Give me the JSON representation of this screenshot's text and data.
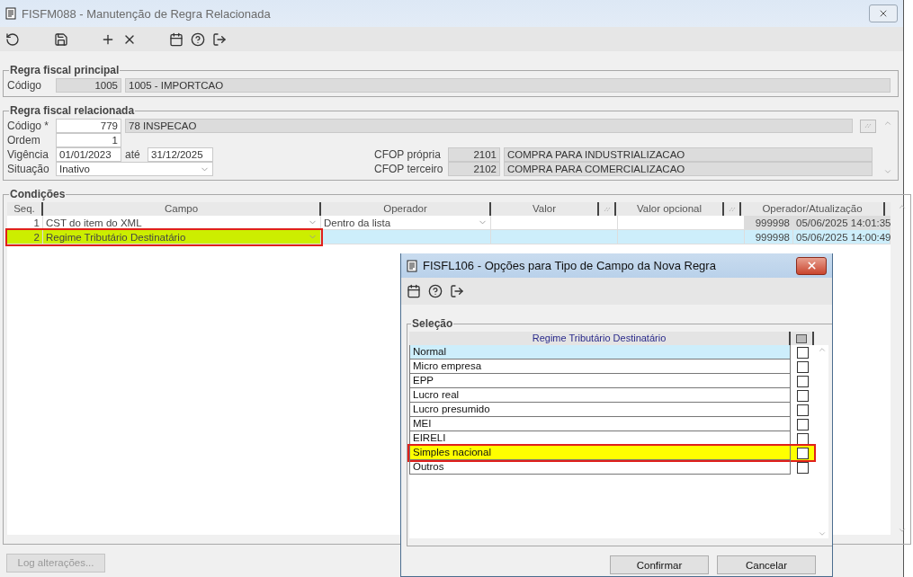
{
  "window": {
    "title": "FISFM088 - Manutenção de Regra Relacionada"
  },
  "regra_principal": {
    "legend": "Regra fiscal principal",
    "label": "Código",
    "code": "1005",
    "description": "1005 - IMPORTCAO"
  },
  "regra_relacionada": {
    "legend": "Regra fiscal relacionada",
    "codigo_label": "Código *",
    "codigo": "779",
    "descricao": "78 INSPECAO",
    "ordem_label": "Ordem",
    "ordem": "1",
    "vigencia_label": "Vigência",
    "vigencia_inicio": "01/01/2023",
    "ate_label": "até",
    "vigencia_fim": "31/12/2025",
    "situacao_label": "Situação",
    "situacao": "Inativo",
    "cfop": [
      {
        "label": "CFOP própria",
        "code": "2101",
        "description": "COMPRA PARA INDUSTRIALIZACAO"
      },
      {
        "label": "CFOP terceiro",
        "code": "2102",
        "description": "COMPRA PARA COMERCIALIZACAO"
      }
    ]
  },
  "condicoes": {
    "legend": "Condições",
    "columns": [
      "Seq.",
      "Campo",
      "Operador",
      "Valor",
      "Valor opcional",
      "Operador/Atualização"
    ],
    "rows": [
      {
        "seq": "1",
        "campo": "CST do item do XML",
        "operador": "Dentro da lista",
        "usuario": "999998",
        "atualizacao": "05/06/2025 14:01:35",
        "selected": false,
        "highlighted": false
      },
      {
        "seq": "2",
        "campo": "Regime Tributário Destinatário",
        "usuario": "999998",
        "atualizacao": "05/06/2025 14:00:49",
        "selected": true,
        "highlighted": true
      }
    ]
  },
  "log_button": {
    "label": "Log alterações...",
    "disabled": true
  },
  "dialog": {
    "title": "FISFL106 - Opções para Tipo de Campo da Nova Regra",
    "legend": "Seleção",
    "column": "Regime Tributário Destinatário",
    "select_all_checked": false,
    "options": [
      {
        "label": "Normal",
        "checked": false,
        "selected": true,
        "highlighted": false
      },
      {
        "label": "Micro empresa",
        "checked": false,
        "selected": false,
        "highlighted": false
      },
      {
        "label": "EPP",
        "checked": false,
        "selected": false,
        "highlighted": false
      },
      {
        "label": "Lucro real",
        "checked": false,
        "selected": false,
        "highlighted": false
      },
      {
        "label": "Lucro presumido",
        "checked": false,
        "selected": false,
        "highlighted": false
      },
      {
        "label": "MEI",
        "checked": false,
        "selected": false,
        "highlighted": false
      },
      {
        "label": "EIRELI",
        "checked": false,
        "selected": false,
        "highlighted": false
      },
      {
        "label": "Simples nacional",
        "checked": false,
        "selected": false,
        "highlighted": true
      },
      {
        "label": "Outros",
        "checked": false,
        "selected": false,
        "highlighted": false
      }
    ],
    "buttons": [
      "Confirmar",
      "Cancelar"
    ]
  }
}
